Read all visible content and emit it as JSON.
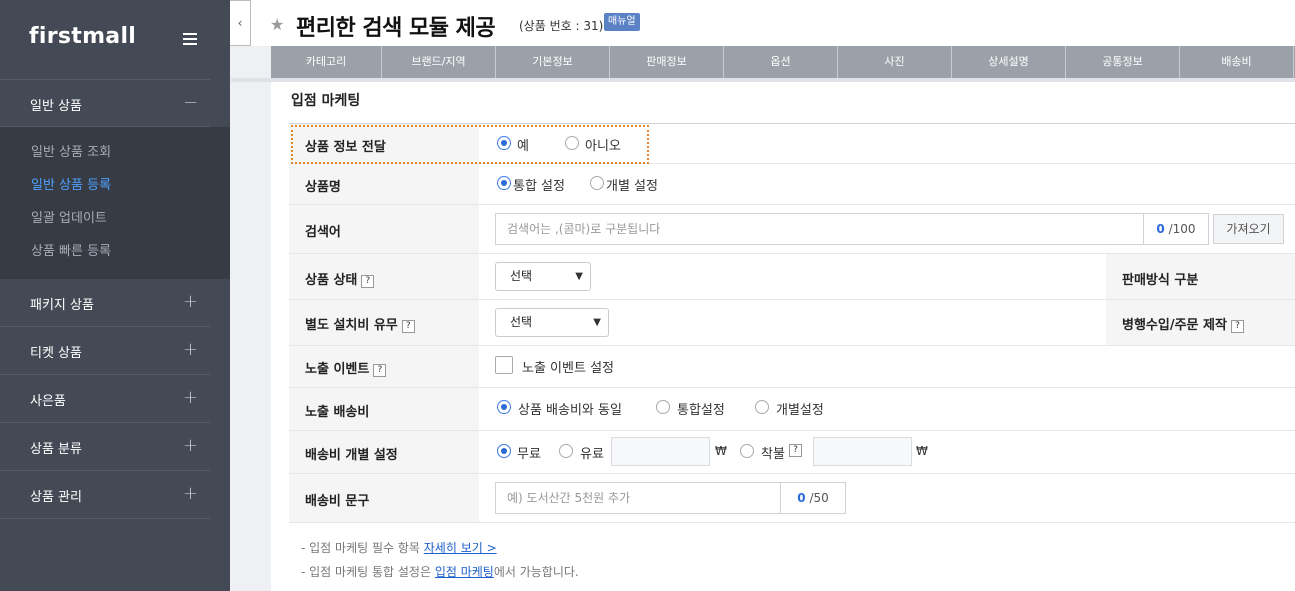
{
  "sidebar": {
    "logo": "firstmall",
    "sections": [
      {
        "label": "일반 상품",
        "sign": "−"
      },
      {
        "label": "패키지 상품",
        "sign": "+"
      },
      {
        "label": "티켓 상품",
        "sign": "+"
      },
      {
        "label": "사은품",
        "sign": "+"
      },
      {
        "label": "상품 분류",
        "sign": "+"
      },
      {
        "label": "상품 관리",
        "sign": "+"
      }
    ],
    "submenu": [
      "일반 상품 조회",
      "일반 상품 등록",
      "일괄 업데이트",
      "상품 빠른 등록"
    ],
    "active_submenu": "일반 상품 등록"
  },
  "header": {
    "collapse_icon": "‹",
    "star": "★",
    "title": "편리한 검색 모듈 제공",
    "product_no": "(상품 번호 : 31)",
    "manual_label": "매뉴얼"
  },
  "tabs": [
    "카테고리",
    "브랜드/지역",
    "기본정보",
    "판매정보",
    "옵션",
    "사진",
    "상세설명",
    "공통정보",
    "배송비"
  ],
  "section_title": "입점 마케팅",
  "form": {
    "info_transfer": {
      "label": "상품 정보 전달",
      "yes": "예",
      "no": "아니오",
      "selected": "예"
    },
    "product_name": {
      "label": "상품명",
      "opt1": "통합 설정",
      "opt2": "개별 설정",
      "selected": "통합 설정"
    },
    "keyword": {
      "label": "검색어",
      "placeholder": "검색어는 ,(콤마)로 구분됩니다",
      "count": "0",
      "max": "/100",
      "fetch_btn": "가져오기"
    },
    "status": {
      "label": "상품 상태",
      "help": "?",
      "select_value": "선택",
      "right_label": "판매방식 구분"
    },
    "install_fee": {
      "label": "별도 설치비 유무",
      "help": "?",
      "select_value": "선택",
      "right_label": "병행수입/주문 제작",
      "right_help": "?"
    },
    "event": {
      "label": "노출 이벤트",
      "help": "?",
      "checkbox_label": "노출 이벤트 설정"
    },
    "shipping": {
      "label": "노출 배송비",
      "opt1": "상품 배송비와 동일",
      "opt2": "통합설정",
      "opt3": "개별설정",
      "selected": "상품 배송비와 동일"
    },
    "shipping_individual": {
      "label": "배송비 개별 설정",
      "opt1": "무료",
      "opt2": "유료",
      "opt3": "착불",
      "help": "?",
      "won1": "₩",
      "won2": "₩",
      "selected": "무료"
    },
    "shipping_text": {
      "label": "배송비 문구",
      "placeholder": "예) 도서산간 5천원 추가",
      "count": "0",
      "max": "/50"
    }
  },
  "notes": {
    "line1_prefix": "-  입점 마케팅 필수 항목 ",
    "line1_link": "자세히 보기 >",
    "line2_prefix": "-  입점 마케팅 통합 설정은 ",
    "line2_link": "입점 마케팅",
    "line2_suffix": "에서 가능합니다."
  },
  "colors": {
    "sidebar_bg": "#444a55",
    "submenu_bg": "#363b44",
    "accent": "#4ea1ff",
    "tab_bg": "#9aa1a9",
    "highlight_border": "#e08a2a"
  }
}
